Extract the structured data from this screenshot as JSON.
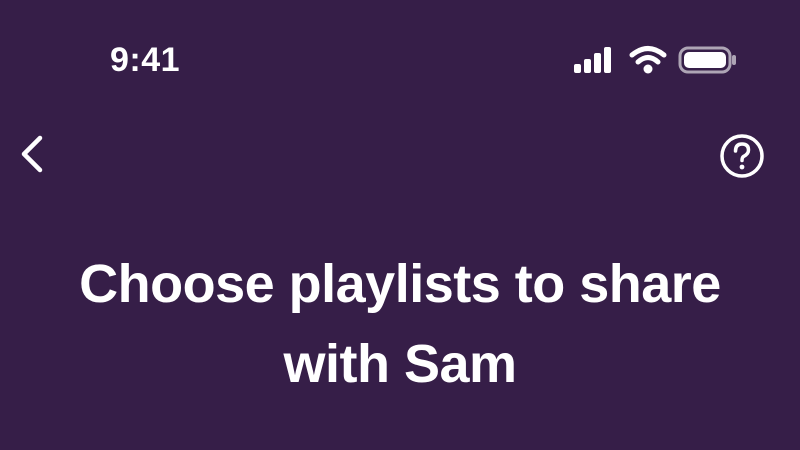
{
  "status_bar": {
    "time": "9:41",
    "icons": [
      "cellular-signal-icon",
      "wifi-icon",
      "battery-icon"
    ]
  },
  "nav": {
    "back_icon": "chevron-left-icon",
    "help_icon": "help-circle-icon"
  },
  "main": {
    "title": "Choose playlists to share with Sam"
  },
  "colors": {
    "background": "#361e48",
    "foreground": "#ffffff"
  }
}
